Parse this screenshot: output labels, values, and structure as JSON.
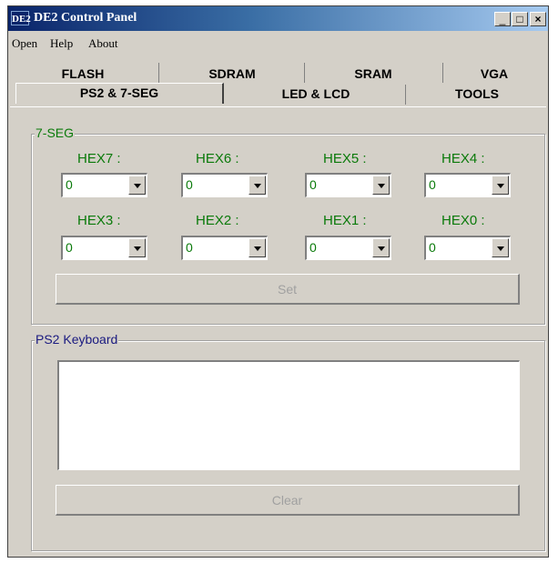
{
  "window": {
    "app_icon_text": "DE2",
    "title": "DE2 Control Panel",
    "minimize": "_",
    "maximize": "□",
    "close": "×"
  },
  "menu": {
    "open": "Open",
    "help": "Help",
    "about": "About"
  },
  "tabs": {
    "row1": [
      "FLASH",
      "SDRAM",
      "SRAM",
      "VGA"
    ],
    "row2": [
      "PS2 & 7-SEG",
      "LED & LCD",
      "TOOLS"
    ],
    "active": "PS2 & 7-SEG"
  },
  "seven_seg": {
    "group_label": "7-SEG",
    "hex": [
      {
        "label": "HEX7 :",
        "value": "0"
      },
      {
        "label": "HEX6 :",
        "value": "0"
      },
      {
        "label": "HEX5 :",
        "value": "0"
      },
      {
        "label": "HEX4 :",
        "value": "0"
      },
      {
        "label": "HEX3 :",
        "value": "0"
      },
      {
        "label": "HEX2 :",
        "value": "0"
      },
      {
        "label": "HEX1 :",
        "value": "0"
      },
      {
        "label": "HEX0 :",
        "value": "0"
      }
    ],
    "set_button": "Set"
  },
  "ps2": {
    "group_label": "PS2 Keyboard",
    "text": "",
    "clear_button": "Clear"
  },
  "colors": {
    "title_gradient_start": "#0a246a",
    "hex_label_color": "#0a7a0a",
    "ps2_label_color": "#1a1a80"
  }
}
